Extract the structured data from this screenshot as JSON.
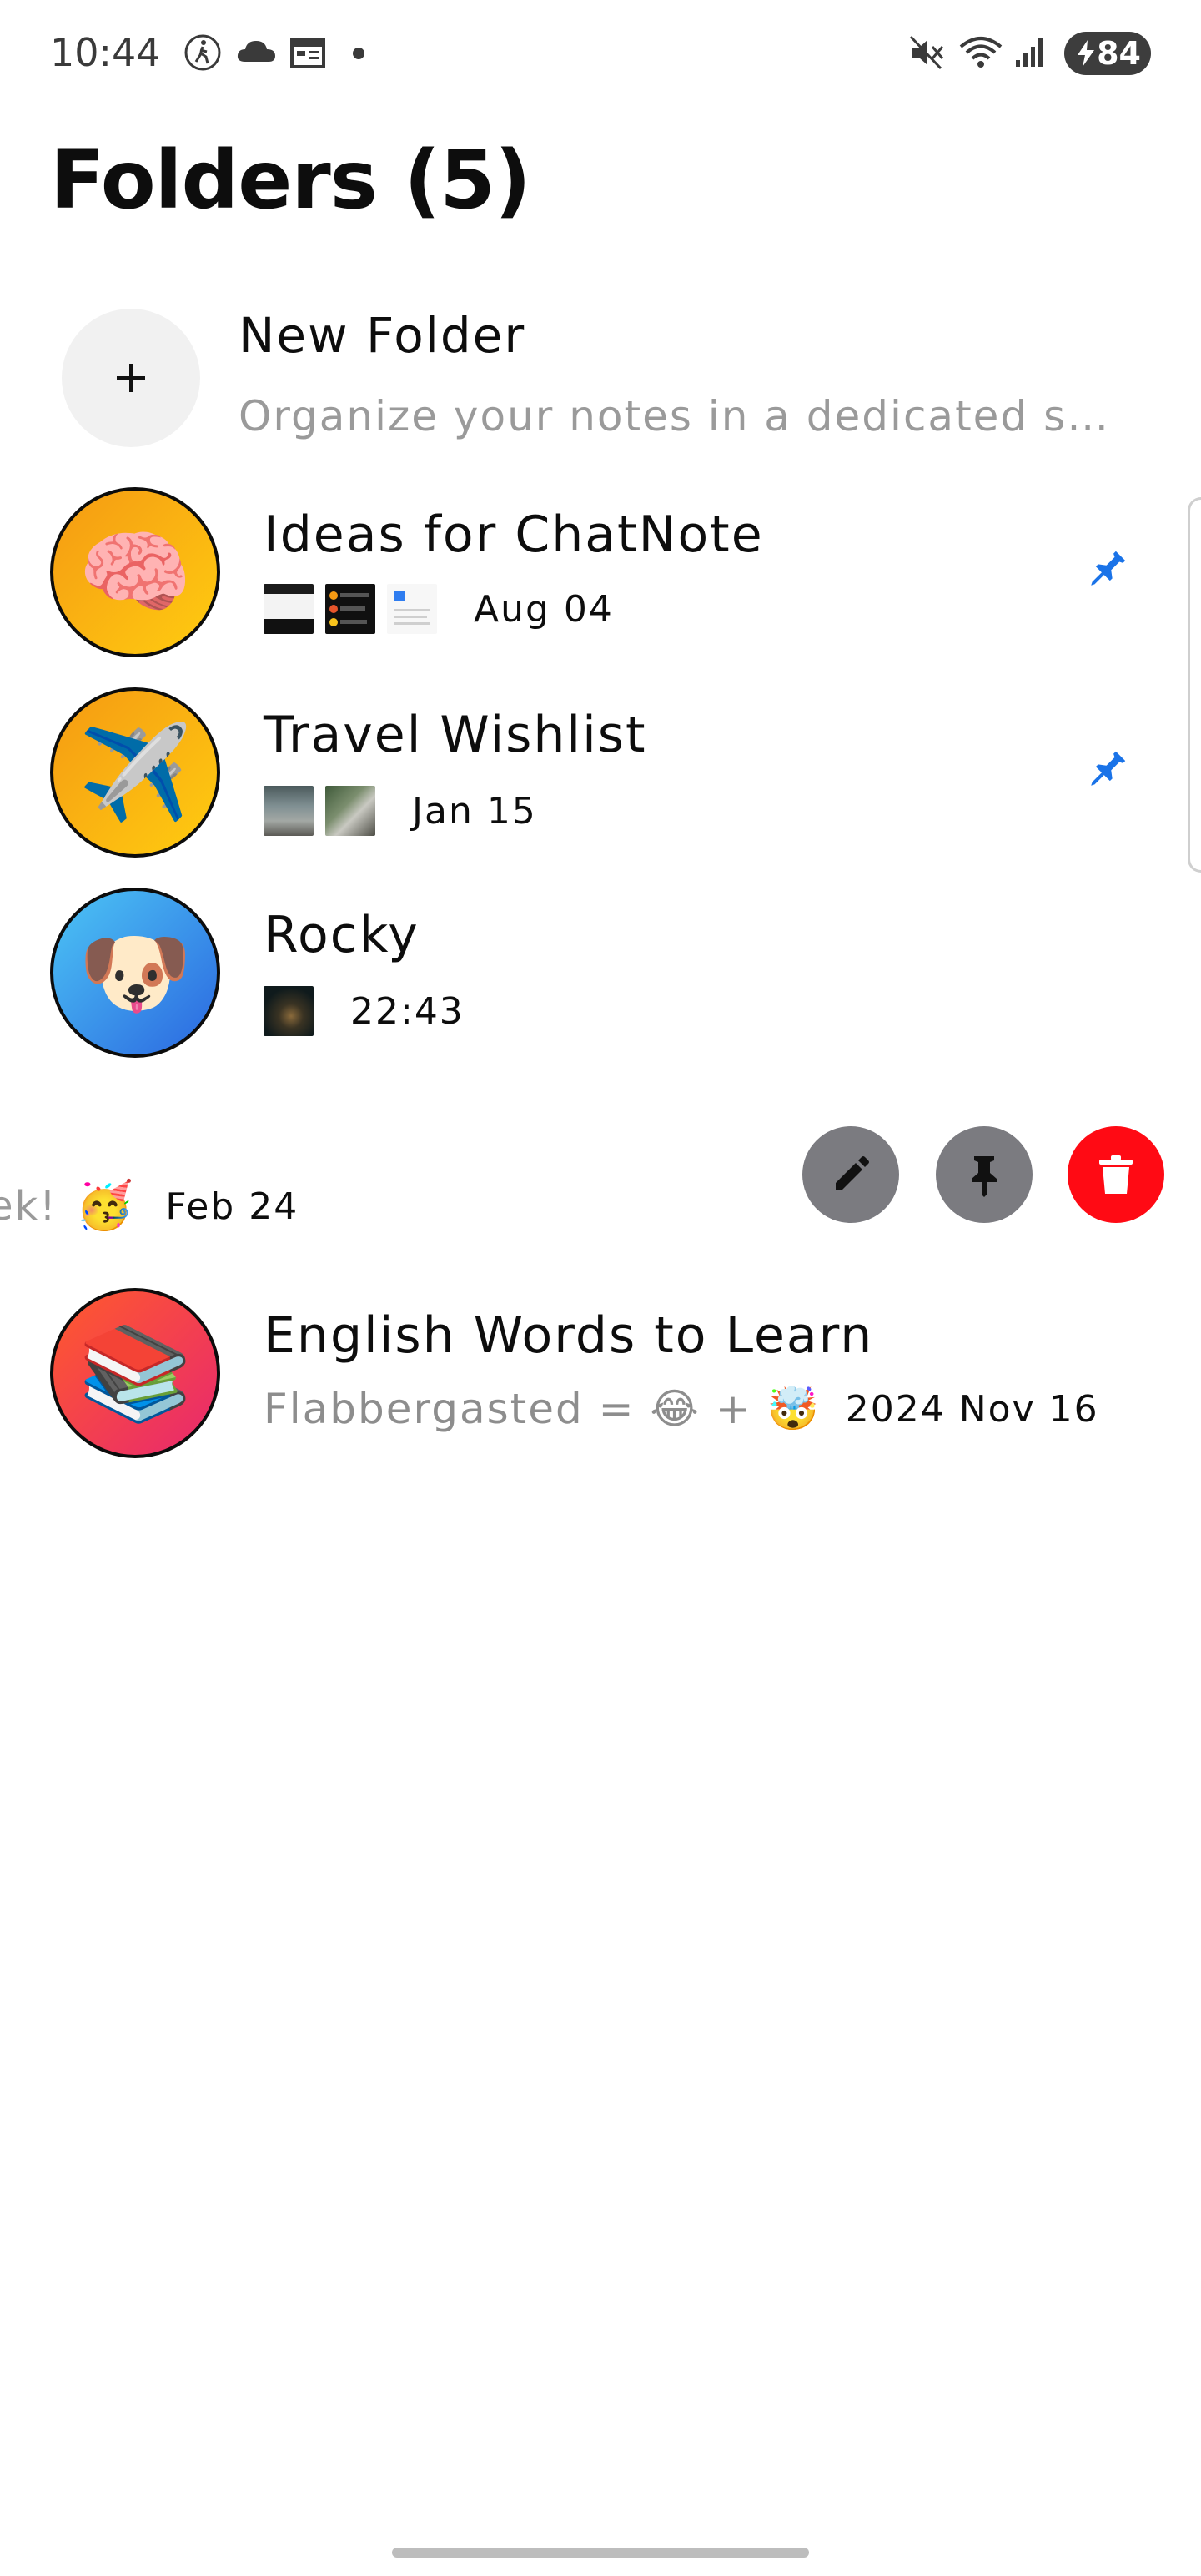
{
  "status_bar": {
    "time": "10:44",
    "battery": "84",
    "icons": [
      "accessibility-icon",
      "cloud-icon",
      "calendar-icon",
      "dot-icon",
      "mute-icon",
      "wifi-icon",
      "signal-icon",
      "charging-bolt-icon"
    ]
  },
  "page": {
    "title": "Folders (5)"
  },
  "new_folder": {
    "icon": "plus-icon",
    "title": "New Folder",
    "subtitle": "Organize your notes in a dedicated s…"
  },
  "folders": [
    {
      "name": "Ideas for ChatNote",
      "emoji": "🧠",
      "date": "Aug 04",
      "pinned": true,
      "thumbnails": [
        "screenshot-thumb",
        "screenshot-thumb",
        "screenshot-thumb"
      ]
    },
    {
      "name": "Travel Wishlist",
      "emoji": "✈️",
      "date": "Jan 15",
      "pinned": true,
      "thumbnails": [
        "photo-thumb",
        "photo-thumb"
      ]
    },
    {
      "name": "Rocky",
      "emoji": "🐶",
      "date": "22:43",
      "pinned": false,
      "thumbnails": [
        "photo-thumb"
      ]
    },
    {
      "name": "English Words to Learn",
      "emoji": "📚",
      "preview": "Flabbergasted = 😂 + 🤯",
      "date": "2024 Nov 16",
      "pinned": false
    }
  ],
  "swiped_row": {
    "preview_text": "ek!",
    "emoji": "🥳",
    "date": "Feb 24",
    "actions": [
      "edit-icon",
      "pin-icon",
      "delete-icon"
    ]
  },
  "colors": {
    "pin_blue": "#1a73e8",
    "delete_red": "#ff0a14",
    "action_gray": "#7b7b80"
  }
}
